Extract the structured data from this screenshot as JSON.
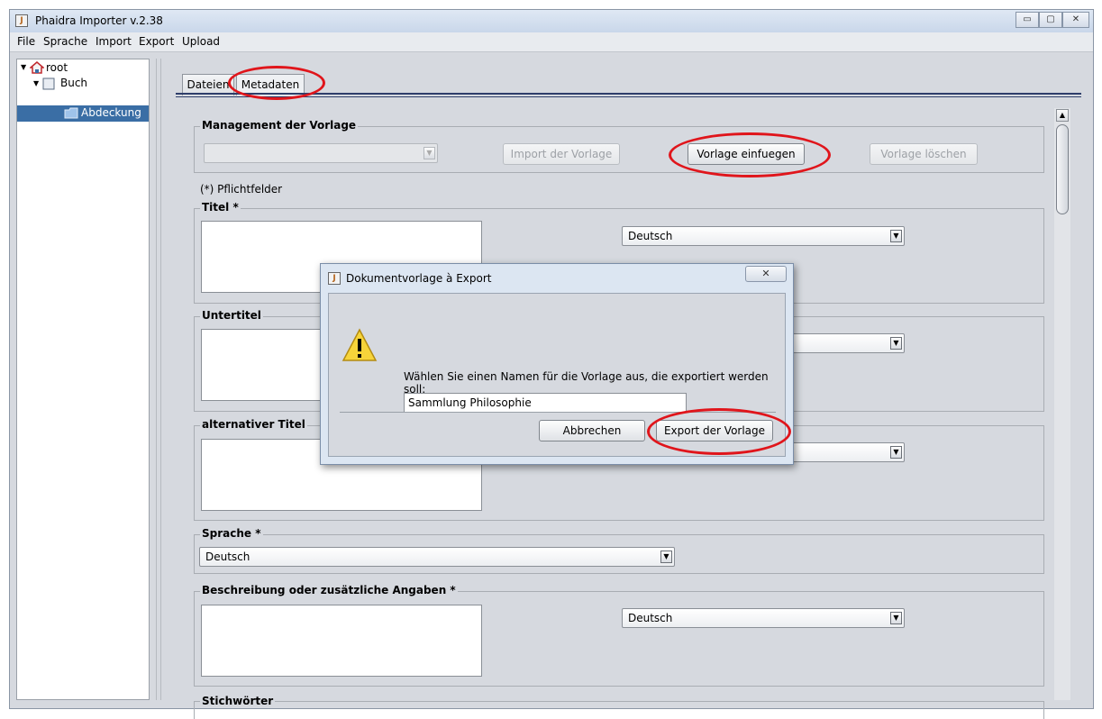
{
  "window": {
    "title": "Phaidra Importer v.2.38",
    "java_icon": "java-cup-icon",
    "minimize_glyph": "▭",
    "maximize_glyph": "▢",
    "close_glyph": "✕"
  },
  "menu": [
    "File",
    "Sprache",
    "Import",
    "Export",
    "Upload"
  ],
  "tree": {
    "root": "root",
    "child": "Buch",
    "leaf": "Abdeckung"
  },
  "tabs": {
    "files": "Dateien",
    "metadata": "Metadaten"
  },
  "template_management": {
    "label": "Management der Vorlage",
    "combo_value": "",
    "import_button": "Import der Vorlage",
    "insert_button": "Vorlage einfuegen",
    "delete_button": "Vorlage löschen"
  },
  "required_note": "(*) Pflichtfelder",
  "fields": {
    "title_label": "Titel *",
    "title_language": "Deutsch",
    "subtitle_label": "Untertitel",
    "alt_title_label": "alternativer Titel",
    "language_label": "Sprache *",
    "language_value": "Deutsch",
    "description_label": "Beschreibung oder zusätzliche Angaben *",
    "description_language": "Deutsch",
    "keywords_label": "Stichwörter"
  },
  "dialog": {
    "title": "Dokumentvorlage à Export",
    "message": "Wählen Sie einen Namen für die Vorlage aus, die exportiert werden soll:",
    "input_value": "Sammlung Philosophie",
    "cancel_button": "Abbrechen",
    "export_button": "Export der Vorlage",
    "close_glyph": "✕"
  },
  "colors": {
    "highlight_ring": "#e0151b",
    "selection": "#3a6ea5"
  }
}
